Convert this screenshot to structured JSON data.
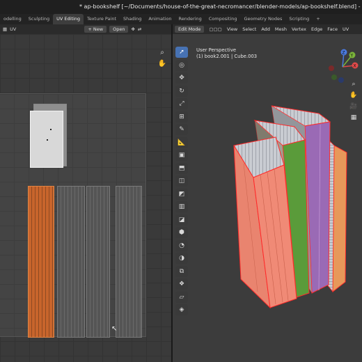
{
  "window": {
    "title": "* ap-bookshelf [~/Documents/house-of-the-great-necromancer/blender-models/ap-bookshelf.blend] - Ble"
  },
  "workspaces": [
    "odelling",
    "Sculpting",
    "UV Editing",
    "Texture Paint",
    "Shading",
    "Animation",
    "Rendering",
    "Compositing",
    "Geometry Nodes",
    "Scripting",
    "+"
  ],
  "active_workspace": "UV Editing",
  "uv_editor": {
    "menu_uv": "UV",
    "new_label": "+ New",
    "open_label": "Open",
    "icons": [
      "zoom-icon",
      "hand-icon"
    ]
  },
  "viewport": {
    "mode": "Edit Mode",
    "menus": [
      "View",
      "Select",
      "Add",
      "Mesh",
      "Vertex",
      "Edge",
      "Face",
      "UV"
    ],
    "info_line1": "User Perspective",
    "info_line2": "(1) book2.001 | Cube.003",
    "gizmo_labels": {
      "x": "X",
      "y": "Y",
      "z": "Z"
    }
  },
  "colors": {
    "selected_edge": "#ff2a2a",
    "book_salmon": "#f08a76",
    "book_green": "#5a9b3a",
    "book_purple": "#9a6ab5",
    "book_orange": "#e7985a",
    "active_tool": "#4772b3",
    "uv_selected_island": "#c8652c"
  }
}
